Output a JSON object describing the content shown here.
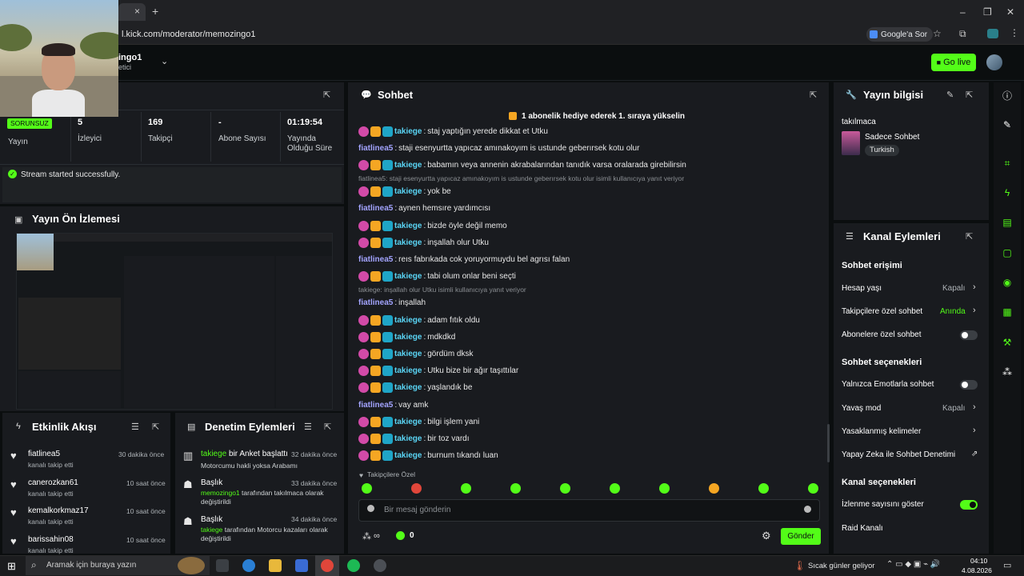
{
  "browser": {
    "url": "l.kick.com/moderator/memozingo1",
    "google_sor": "Google'a Sor",
    "tab_close": "×",
    "tab_add": "+"
  },
  "header": {
    "channel": "ingo1",
    "role": "etici",
    "go_live": "Go live"
  },
  "webcam": {
    "badge": "SORUNSUZ"
  },
  "stream": {
    "stats": [
      {
        "value": "",
        "label": "Yayın"
      },
      {
        "value": "5",
        "label": "İzleyici"
      },
      {
        "value": "169",
        "label": "Takipçi"
      },
      {
        "value": "-",
        "label": "Abone Sayısı"
      },
      {
        "value": "01:19:54",
        "label": "Yayında Olduğu Süre"
      }
    ],
    "success": "Stream started successfully."
  },
  "preview": {
    "title": "Yayın Ön İzlemesi"
  },
  "activity": {
    "title": "Etkinlik Akışı",
    "items": [
      {
        "name": "fiatlinea5",
        "sub": "kanalı takip etti",
        "time": "30 dakika önce"
      },
      {
        "name": "canerozkan61",
        "sub": "kanalı takip etti",
        "time": "10 saat önce"
      },
      {
        "name": "kemalkorkmaz17",
        "sub": "kanalı takip etti",
        "time": "10 saat önce"
      },
      {
        "name": "barissahin08",
        "sub": "kanalı takip etti",
        "time": "10 saat önce"
      }
    ]
  },
  "moderation": {
    "title": "Denetim Eylemleri",
    "items": [
      {
        "title_user": "takiege",
        "title_rest": " bir Anket başlattı",
        "time": "32 dakika önce",
        "sub_user": "",
        "sub": "Motorcumu hakli yoksa Arabamı"
      },
      {
        "title_user": "",
        "title_rest": "Başlık",
        "time": "33 dakika önce",
        "sub_user": "memozingo1",
        "sub": " tarafından takılmaca olarak değiştirildi"
      },
      {
        "title_user": "",
        "title_rest": "Başlık",
        "time": "34 dakika önce",
        "sub_user": "takiege",
        "sub": " tarafından Motorcu kazaları olarak değiştirildi"
      }
    ]
  },
  "chat": {
    "title": "Sohbet",
    "pinned": "1 abonelik hediye ederek 1. sıraya yükselin",
    "messages": [
      {
        "user": "takiege",
        "text": "staj yaptığın yerede dikkat et Utku",
        "badges": true
      },
      {
        "user": "fiatlinea5",
        "text": "staji esenyurtta yapıcaz amınakoyım is ustunde geberırsek kotu olur",
        "badges": false
      },
      {
        "user": "takiege",
        "text": "babamın veya annenin akrabalarından tanıdık varsa oralarada girebilirsin",
        "badges": true
      },
      {
        "reply": "fiatlinea5: staji esenyurtta yapıcaz amınakoyım is ustunde geberırsek kotu olur isimli kullanıcıya yanıt veriyor",
        "user": "takiege",
        "text": "yok be",
        "badges": true
      },
      {
        "user": "fiatlinea5",
        "text": "aynen hemsıre yardımcısı",
        "badges": false
      },
      {
        "user": "takiege",
        "text": "bizde öyle değil memo",
        "badges": true
      },
      {
        "user": "takiege",
        "text": "inşallah olur Utku",
        "badges": true
      },
      {
        "user": "fiatlinea5",
        "text": "reıs fabrıkada cok yoruyormuydu bel agrısı falan",
        "badges": false
      },
      {
        "user": "takiege",
        "text": "tabi olum onlar beni seçti",
        "badges": true
      },
      {
        "reply": "takiege: inşallah olur Utku isimli kullanıcıya yanıt veriyor",
        "user": "fiatlinea5",
        "text": "inşallah",
        "badges": false
      },
      {
        "user": "takiege",
        "text": "adam fıtık oldu",
        "badges": true
      },
      {
        "user": "takiege",
        "text": "mdkdkd",
        "badges": true
      },
      {
        "user": "takiege",
        "text": "gördüm dksk",
        "badges": true
      },
      {
        "user": "takiege",
        "text": "Utku bize bir ağır taşıttılar",
        "badges": true
      },
      {
        "user": "takiege",
        "text": "yaşlandık be",
        "badges": true
      },
      {
        "user": "fiatlinea5",
        "text": "vay amk",
        "badges": false
      },
      {
        "user": "takiege",
        "text": "bilgi işlem yani",
        "badges": true
      },
      {
        "user": "takiege",
        "text": "bir toz vardı",
        "badges": true
      },
      {
        "user": "takiege",
        "text": "burnum tıkandı luan",
        "badges": true
      }
    ],
    "followers_only": "Takipçilere Özel",
    "input_placeholder": "Bir mesaj gönderin",
    "points": "0",
    "send": "Gönder"
  },
  "stream_info": {
    "title": "Yayın bilgisi",
    "stream_title": "takılmaca",
    "category": "Sadece Sohbet",
    "language": "Turkish"
  },
  "channel_actions": {
    "title": "Kanal Eylemleri",
    "chat_access": "Sohbet erişimi",
    "account_age": {
      "label": "Hesap yaşı",
      "value": "Kapalı"
    },
    "followers_chat": {
      "label": "Takipçilere özel sohbet",
      "value": "Anında"
    },
    "subs_chat": {
      "label": "Abonelere özel sohbet",
      "on": false
    },
    "chat_options": "Sohbet seçenekleri",
    "emote_only": {
      "label": "Yalnızca Emotlarla sohbet",
      "on": false
    },
    "slow_mode": {
      "label": "Yavaş mod",
      "value": "Kapalı"
    },
    "banned_words": {
      "label": "Yasaklanmış kelimeler"
    },
    "ai_moderation": {
      "label": "Yapay Zeka ile Sohbet Denetimi"
    },
    "channel_options": "Kanal seçenekleri",
    "show_viewers": {
      "label": "İzlenme sayısını göster",
      "on": true
    },
    "raid": {
      "label": "Raid Kanalı"
    }
  },
  "taskbar": {
    "search": "Aramak için buraya yazın",
    "weather": "Sıcak günler geliyor",
    "time": "04:10",
    "date": "4.08.2026"
  },
  "colors": {
    "accent": "#53fc18",
    "bg": "#0b0e0f",
    "panel": "#191b1f"
  }
}
